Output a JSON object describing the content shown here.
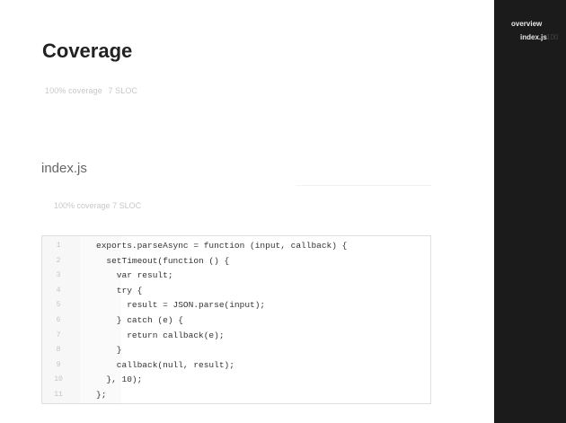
{
  "main": {
    "title": "Coverage",
    "coverage": "100% coverage",
    "sloc": "7 SLOC"
  },
  "file": {
    "name": "index.js",
    "coverage": "100% coverage",
    "sloc": "7 SLOC",
    "lines": [
      {
        "n": "1",
        "hits": "",
        "code": "exports.parseAsync = function (input, callback) {"
      },
      {
        "n": "2",
        "hits": "",
        "code": "  setTimeout(function () {"
      },
      {
        "n": "3",
        "hits": "",
        "code": "    var result;"
      },
      {
        "n": "4",
        "hits": "",
        "code": "    try {"
      },
      {
        "n": "5",
        "hits": "",
        "code": "      result = JSON.parse(input);"
      },
      {
        "n": "6",
        "hits": "",
        "code": "    } catch (e) {"
      },
      {
        "n": "7",
        "hits": "",
        "code": "      return callback(e);"
      },
      {
        "n": "8",
        "hits": "",
        "code": "    }"
      },
      {
        "n": "9",
        "hits": "",
        "code": "    callback(null, result);"
      },
      {
        "n": "10",
        "hits": "",
        "code": "  }, 10);"
      },
      {
        "n": "11",
        "hits": "",
        "code": "};"
      }
    ]
  },
  "sidebar": {
    "overview_label": "overview",
    "file_label": "index.js",
    "file_coverage": "100"
  },
  "colors": {
    "sidebar_bg": "#1b1b1b",
    "title": "#222222",
    "muted": "#c8c8c8"
  }
}
